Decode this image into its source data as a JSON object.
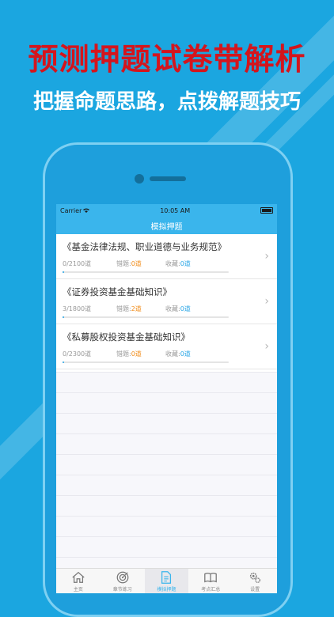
{
  "promo": {
    "headline": "预测押题试卷带解析",
    "subline": "把握命题思路，点拨解题技巧"
  },
  "status_bar": {
    "carrier": "Carrier",
    "time": "10:05 AM"
  },
  "nav": {
    "title": "模拟押题"
  },
  "exams": [
    {
      "title": "《基金法律法规、职业道德与业务规范》",
      "progress": "0/2100道",
      "progress_fraction": 0.0,
      "error_label": "错题:",
      "error_count": "0道",
      "fav_label": "收藏:",
      "fav_count": "0道"
    },
    {
      "title": "《证券投资基金基础知识》",
      "progress": "3/1800道",
      "progress_fraction": 0.0017,
      "error_label": "错题:",
      "error_count": "2道",
      "fav_label": "收藏:",
      "fav_count": "0道"
    },
    {
      "title": "《私募股权投资基金基础知识》",
      "progress": "0/2300道",
      "progress_fraction": 0.0,
      "error_label": "错题:",
      "error_count": "0道",
      "fav_label": "收藏:",
      "fav_count": "0道"
    }
  ],
  "tabs": [
    {
      "label": "主页",
      "icon": "home-icon"
    },
    {
      "label": "章节练习",
      "icon": "target-icon"
    },
    {
      "label": "模拟押题",
      "icon": "document-icon",
      "active": true
    },
    {
      "label": "考点汇总",
      "icon": "book-icon"
    },
    {
      "label": "设置",
      "icon": "gears-icon"
    }
  ],
  "colors": {
    "background": "#1ba6e0",
    "headline": "#d4151d",
    "nav_bar": "#3ab5ec",
    "error_count": "#f08c1a",
    "fav_count": "#2aa6e6"
  }
}
